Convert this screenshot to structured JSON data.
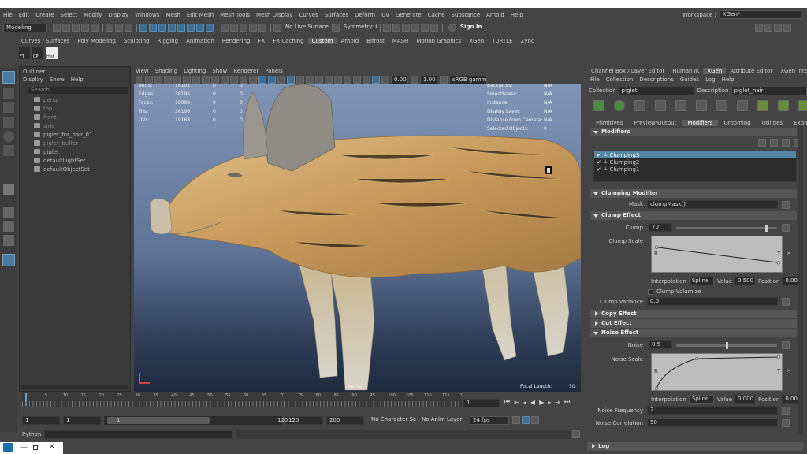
{
  "menu": [
    "File",
    "Edit",
    "Create",
    "Select",
    "Modify",
    "Display",
    "Windows",
    "Mesh",
    "Edit Mesh",
    "Mesh Tools",
    "Mesh Display",
    "Curves",
    "Surfaces",
    "Deform",
    "UV",
    "Generate",
    "Cache",
    "Substance",
    "Arnold",
    "Help"
  ],
  "workspace": {
    "label": "Workspace :",
    "value": "XGen*"
  },
  "status_line": {
    "mode": "Modeling",
    "live": "No Live Surface",
    "symmetry": "Symmetry: Off",
    "sign_in": "Sign In"
  },
  "shelf_tabs": [
    "Curves / Surfaces",
    "Poly Modeling",
    "Sculpting",
    "Rigging",
    "Animation",
    "Rendering",
    "FX",
    "FX Caching",
    "Custom",
    "Arnold",
    "Bifrost",
    "MASH",
    "Motion Graphics",
    "XGen",
    "TURTLE",
    "Zync"
  ],
  "shelf_active": "Custom",
  "shelf_icons": [
    "FT",
    "CP",
    "Hist"
  ],
  "outliner": {
    "title": "Outliner",
    "menu": [
      "Display",
      "Show",
      "Help"
    ],
    "search": "Search...",
    "items": [
      {
        "name": "persp",
        "dim": true
      },
      {
        "name": "top",
        "dim": true
      },
      {
        "name": "front",
        "dim": true
      },
      {
        "name": "side",
        "dim": true
      },
      {
        "name": "piglet_for_hair_01",
        "dim": false
      },
      {
        "name": "piglet_buffer",
        "dim": true
      },
      {
        "name": "piglet",
        "dim": false
      },
      {
        "name": "defaultLightSet",
        "dim": false
      },
      {
        "name": "defaultObjectSet",
        "dim": false
      }
    ]
  },
  "viewport": {
    "menu": [
      "View",
      "Shading",
      "Lighting",
      "Show",
      "Renderer",
      "Panels"
    ],
    "exposure": "0.00",
    "gamma": "1.00",
    "colorspace": "sRGB gamma",
    "hud_left": [
      {
        "label": "Verts:",
        "a": "18101",
        "b": "0",
        "c": "0"
      },
      {
        "label": "Edges:",
        "a": "36196",
        "b": "0",
        "c": "0"
      },
      {
        "label": "Faces:",
        "a": "18098",
        "b": "0",
        "c": "0"
      },
      {
        "label": "Tris:",
        "a": "36196",
        "b": "0",
        "c": "0"
      },
      {
        "label": "UVs:",
        "a": "19168",
        "b": "0",
        "c": "0"
      }
    ],
    "hud_right": [
      {
        "label": "Backfaces:",
        "value": "N/A"
      },
      {
        "label": "Smoothness:",
        "value": "N/A"
      },
      {
        "label": "Instance:",
        "value": "N/A"
      },
      {
        "label": "Display Layer:",
        "value": "N/A"
      },
      {
        "label": "Distance From Camera:",
        "value": "N/A"
      },
      {
        "label": "Selected Objects:",
        "value": "0"
      }
    ],
    "camera": "persp",
    "focal_label": "Focal Length:",
    "focal_value": "50"
  },
  "timeline": {
    "ticks": [
      "1",
      "5",
      "10",
      "15",
      "20",
      "25",
      "30",
      "35",
      "40",
      "45",
      "50",
      "55",
      "60",
      "65",
      "70",
      "75",
      "80",
      "85",
      "90",
      "95",
      "100",
      "105",
      "110",
      "115",
      "1"
    ],
    "current": "1"
  },
  "range": {
    "start": "1",
    "start2": "1",
    "slider_start": "1",
    "slider_end": "120",
    "end": "120",
    "end2": "200",
    "character": "No Character Set",
    "anim_layer": "No Anim Layer",
    "fps": "24 fps"
  },
  "command": {
    "lang": "Python"
  },
  "right_tabs": [
    "Channel Box / Layer Editor",
    "Human IK",
    "XGen",
    "Attribute Editor",
    "XGen Interactive Gr"
  ],
  "right_tab_active": "XGen",
  "xgen": {
    "menu": [
      "File",
      "Collection",
      "Descriptions",
      "Guides",
      "Log",
      "Help"
    ],
    "collection_label": "Collection",
    "collection": "piglet",
    "description_label": "Description",
    "description": "piglet_hair",
    "subtabs": [
      "Primitives",
      "Preview/Output",
      "Modifiers",
      "Grooming",
      "Utilities",
      "Expressions"
    ],
    "subtab_active": "Modifiers",
    "modifiers_title": "Modifiers",
    "modifiers": [
      "Clumping3",
      "Clumping2",
      "Clumping1"
    ],
    "selected_modifier": "Clumping3",
    "clumping_modifier": "Clumping Modifier",
    "mask_label": "Mask",
    "mask": "clumpMask()",
    "clump_effect": "Clump Effect",
    "clump_label": "Clump",
    "clump": "70",
    "clump_level": 0.9,
    "clump_scale_label": "Clump Scale",
    "clump_curve": [
      [
        0,
        0.75
      ],
      [
        1,
        0.25
      ]
    ],
    "interp_label": "Interpolation",
    "interp": "Spline",
    "value_label": "Value",
    "clump_value": "0.500",
    "position_label": "Position",
    "clump_position": "0.000",
    "clump_volumize": "Clump Volumize",
    "clump_variance_label": "Clump Variance",
    "clump_variance": "0.0",
    "copy_effect": "Copy Effect",
    "cut_effect": "Cut Effect",
    "noise_effect": "Noise Effect",
    "noise_label": "Noise",
    "noise": "0.5",
    "noise_level": 0.5,
    "noise_scale_label": "Noise Scale",
    "noise_curve": [
      [
        0,
        0
      ],
      [
        0.33,
        0.95
      ],
      [
        1,
        1
      ]
    ],
    "noise_value": "0.000",
    "noise_position": "0.000",
    "noise_freq_label": "Noise Frequency",
    "noise_freq": "2",
    "noise_corr_label": "Noise Correlation",
    "noise_corr": "50",
    "curve_left": "R",
    "curve_right": "T",
    "log": "Log"
  },
  "colors": {
    "accent": "#3f6e93",
    "selected": "#5285a6",
    "panel": "#444444",
    "viewport_top": "#7f94b6",
    "viewport_bottom": "#1e2c40",
    "fur": "#c89a58"
  }
}
